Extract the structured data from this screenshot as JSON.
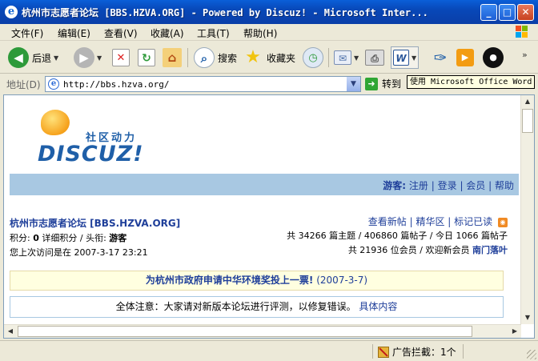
{
  "window": {
    "title": "杭州市志愿者论坛 [BBS.HZVA.ORG] - Powered by Discuz! - Microsoft Inter...",
    "min": "_",
    "max": "□",
    "close": "✕"
  },
  "menu": [
    "文件(F)",
    "编辑(E)",
    "查看(V)",
    "收藏(A)",
    "工具(T)",
    "帮助(H)"
  ],
  "toolbar": {
    "back": "后退",
    "search": "搜索",
    "favorites": "收藏夹"
  },
  "address": {
    "label": "地址(D)",
    "url": "http://bbs.hzva.org/",
    "go": "转到"
  },
  "tooltip": "使用 Microsoft Office Word 编辑",
  "page": {
    "logo_tagline": "社区动力",
    "logo_word": "DISCUZ!",
    "nav": {
      "guest_label": "游客:",
      "links": [
        "注册",
        "登录",
        "会员",
        "帮助"
      ]
    },
    "forum_name": "杭州市志愿者论坛 [BBS.HZVA.ORG]",
    "points_label": "积分:",
    "points_value": "0",
    "points_detail": "详细积分",
    "title_label": "头衔:",
    "title_value": "游客",
    "last_visit_label": "您上次访问是在",
    "last_visit_value": "2007-3-17 23:21",
    "quicklinks": [
      "查看新帖",
      "精华区",
      "标记已读"
    ],
    "stats_line1": "共 34266 篇主题 / 406860 篇帖子 / 今日 1066 篇帖子",
    "stats_line2_prefix": "共 21936 位会员 / 欢迎新会员",
    "new_member": "南门落叶",
    "announcement_title": "为杭州市政府申请中华环境奖投上一票!",
    "announcement_date": "(2007-3-7)",
    "notice_text": "全体注意：大家请对新版本论坛进行评测，以修复错误。",
    "notice_link": "具体内容"
  },
  "status": {
    "popup_blocked": "广告拦截：1个"
  },
  "colors": {
    "titlebar": "#0a5fd8",
    "navband": "#a8c8e2",
    "link": "#1f3f9a",
    "announce_bg": "#ffffe0"
  }
}
